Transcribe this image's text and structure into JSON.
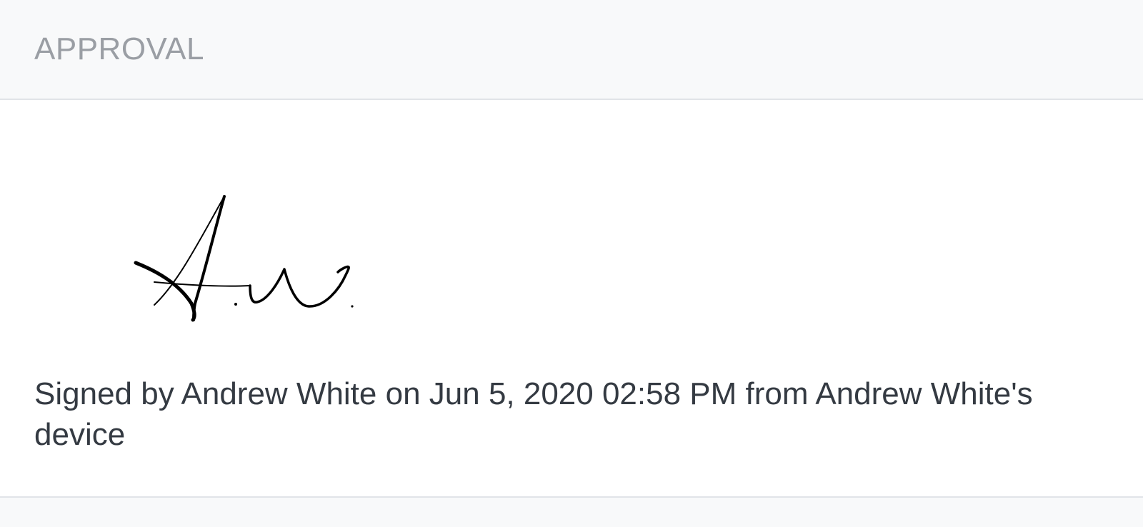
{
  "approval": {
    "title": "APPROVAL",
    "signature_text": "A.W.",
    "signed_text": "Signed by Andrew White on Jun 5, 2020 02:58 PM from Andrew White's device"
  }
}
